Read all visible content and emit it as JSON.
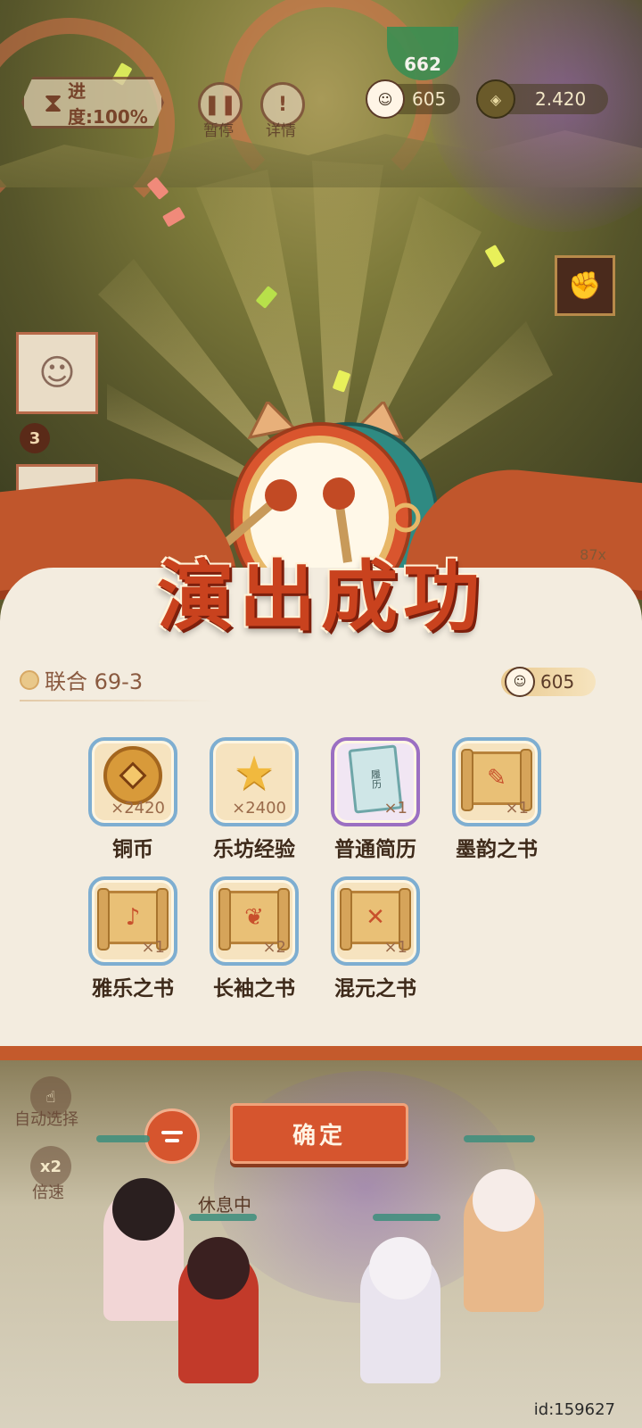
{
  "hud": {
    "progress_label": "进度:100%",
    "pause_label": "暂停",
    "details_label": "详情",
    "pause_icon": "pause-icon",
    "details_icon": "exclamation-icon",
    "fans_count": "605",
    "coins_count": "2.420",
    "score_partial": "662"
  },
  "title": "演出成功",
  "stage": {
    "name": "联合 69-3",
    "fans_reward": "605"
  },
  "left_badge": "3",
  "right_multiplier": "87x",
  "rewards": [
    {
      "name": "铜币",
      "qty": "×2420",
      "icon": "copper-coin-icon"
    },
    {
      "name": "乐坊经验",
      "qty": "×2400",
      "icon": "star-icon"
    },
    {
      "name": "普通简历",
      "qty": "×1",
      "icon": "resume-book-icon",
      "book_text": "履历"
    },
    {
      "name": "墨韵之书",
      "qty": "×1",
      "icon": "brush-scroll-icon"
    },
    {
      "name": "雅乐之书",
      "qty": "×1",
      "icon": "music-scroll-icon"
    },
    {
      "name": "长袖之书",
      "qty": "×2",
      "icon": "sleeve-scroll-icon"
    },
    {
      "name": "混元之书",
      "qty": "×1",
      "icon": "cross-scroll-icon"
    }
  ],
  "bottom": {
    "auto_select_label": "自动选择",
    "speed_icon_text": "x2",
    "speed_label": "倍速",
    "confirm_label": "确定",
    "rest_label": "休息中",
    "id_label": "id:159627"
  },
  "colors": {
    "accent": "#d6552e",
    "panel": "#f3ecdf",
    "title": "#c9421e",
    "item_border_blue": "#7eaed1",
    "item_border_purple": "#9b6fc2"
  }
}
